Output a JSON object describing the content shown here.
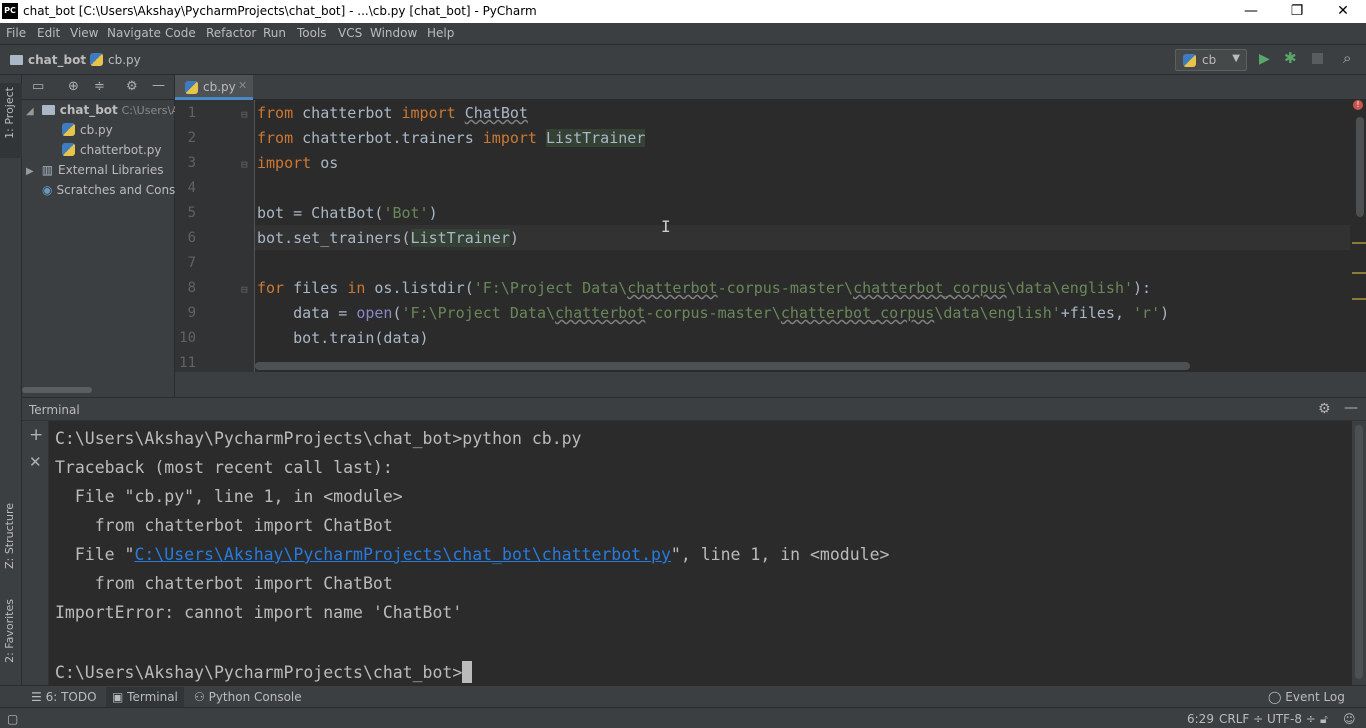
{
  "window": {
    "app_icon": "PC",
    "title": "chat_bot [C:\\Users\\Akshay\\PycharmProjects\\chat_bot] - ...\\cb.py [chat_bot] - PyCharm",
    "minimize": "—",
    "restore": "❐",
    "close": "✕"
  },
  "menu": [
    "File",
    "Edit",
    "View",
    "Navigate",
    "Code",
    "Refactor",
    "Run",
    "Tools",
    "VCS",
    "Window",
    "Help"
  ],
  "breadcrumb": {
    "project": "chat_bot",
    "file": "cb.py"
  },
  "run_config": {
    "name": "cb"
  },
  "left_tabs": {
    "project": "1: Project",
    "structure": "Z: Structure",
    "favorites": "2: Favorites"
  },
  "project_tree": {
    "root": "chat_bot",
    "root_path": "C:\\Users\\Akshay",
    "files": [
      "cb.py",
      "chatterbot.py"
    ],
    "external": "External Libraries",
    "scratches": "Scratches and Consoles"
  },
  "editor": {
    "tab": "cb.py",
    "line_numbers": [
      "1",
      "2",
      "3",
      "4",
      "5",
      "6",
      "7",
      "8",
      "9",
      "10",
      "11"
    ]
  },
  "terminal": {
    "title": "Terminal",
    "lines": [
      "C:\\Users\\Akshay\\PycharmProjects\\chat_bot>python cb.py",
      "Traceback (most recent call last):",
      "  File \"cb.py\", line 1, in <module>",
      "    from chatterbot import ChatBot",
      "    from chatterbot import ChatBot",
      "ImportError: cannot import name 'ChatBot'"
    ],
    "file_line_prefix": "  File \"",
    "file_link": "C:\\Users\\Akshay\\PycharmProjects\\chat_bot\\chatterbot.py",
    "file_line_suffix": "\", line 1, in <module>",
    "prompt": "C:\\Users\\Akshay\\PycharmProjects\\chat_bot>"
  },
  "bottom_tabs": {
    "todo": "6: TODO",
    "terminal": "Terminal",
    "python_console": "Python Console",
    "event_log": "Event Log"
  },
  "status": {
    "position": "6:29",
    "line_sep": "CRLF ÷",
    "encoding": "UTF-8 ÷"
  },
  "icons": [
    "pycharm-icon",
    "folder-icon",
    "python-file-icon",
    "run-icon",
    "debug-icon",
    "stop-icon",
    "search-icon",
    "gear-icon",
    "hide-icon",
    "plus-icon",
    "close-icon",
    "locate-icon",
    "collapse-icon"
  ],
  "colors": {
    "keyword": "#cc7832",
    "string": "#6a8759",
    "link": "#287bde",
    "background": "#2b2b2b"
  }
}
